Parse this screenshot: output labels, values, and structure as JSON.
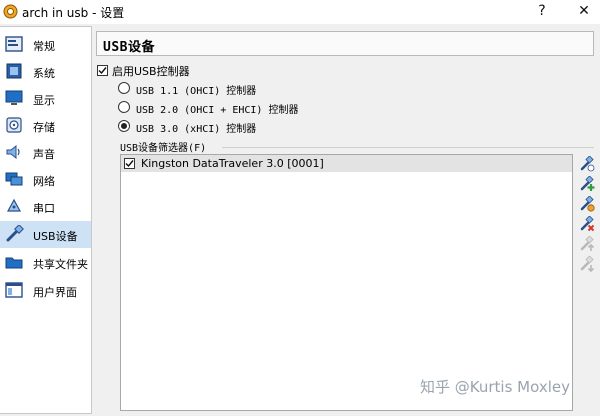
{
  "window": {
    "title": "arch in usb - 设置",
    "help_glyph": "?",
    "close_glyph": "✕"
  },
  "sidebar": {
    "items": [
      {
        "label": "常规",
        "icon": "general-icon"
      },
      {
        "label": "系统",
        "icon": "system-icon"
      },
      {
        "label": "显示",
        "icon": "display-icon"
      },
      {
        "label": "存储",
        "icon": "storage-icon"
      },
      {
        "label": "声音",
        "icon": "audio-icon"
      },
      {
        "label": "网络",
        "icon": "network-icon"
      },
      {
        "label": "串口",
        "icon": "serial-port-icon"
      },
      {
        "label": "USB设备",
        "icon": "usb-icon",
        "selected": true
      },
      {
        "label": "共享文件夹",
        "icon": "shared-folder-icon"
      },
      {
        "label": "用户界面",
        "icon": "user-interface-icon"
      }
    ]
  },
  "main": {
    "header": "USB设备",
    "enable_usb": {
      "label": "启用USB控制器",
      "checked": true
    },
    "controllers": [
      {
        "label": "USB 1.1 (OHCI) 控制器",
        "selected": false
      },
      {
        "label": "USB 2.0 (OHCI + EHCI) 控制器",
        "selected": false
      },
      {
        "label": "USB 3.0 (xHCI) 控制器",
        "selected": true
      }
    ],
    "filters_label": "USB设备筛选器(F)",
    "filters": [
      {
        "label": "Kingston DataTraveler 3.0 [0001]",
        "checked": true
      }
    ],
    "tools": [
      {
        "name": "add-empty-filter-icon",
        "enabled": true
      },
      {
        "name": "add-filter-from-device-icon",
        "enabled": true
      },
      {
        "name": "edit-filter-icon",
        "enabled": true
      },
      {
        "name": "remove-filter-icon",
        "enabled": true
      },
      {
        "name": "move-filter-up-icon",
        "enabled": false
      },
      {
        "name": "move-filter-down-icon",
        "enabled": false
      }
    ]
  },
  "watermark": "知乎 @Kurtis Moxley",
  "colors": {
    "selected_bg": "#cde2f5",
    "accent_blue": "#1f6fc5",
    "accent_green": "#2f9e3a",
    "accent_red": "#d23a2a"
  }
}
